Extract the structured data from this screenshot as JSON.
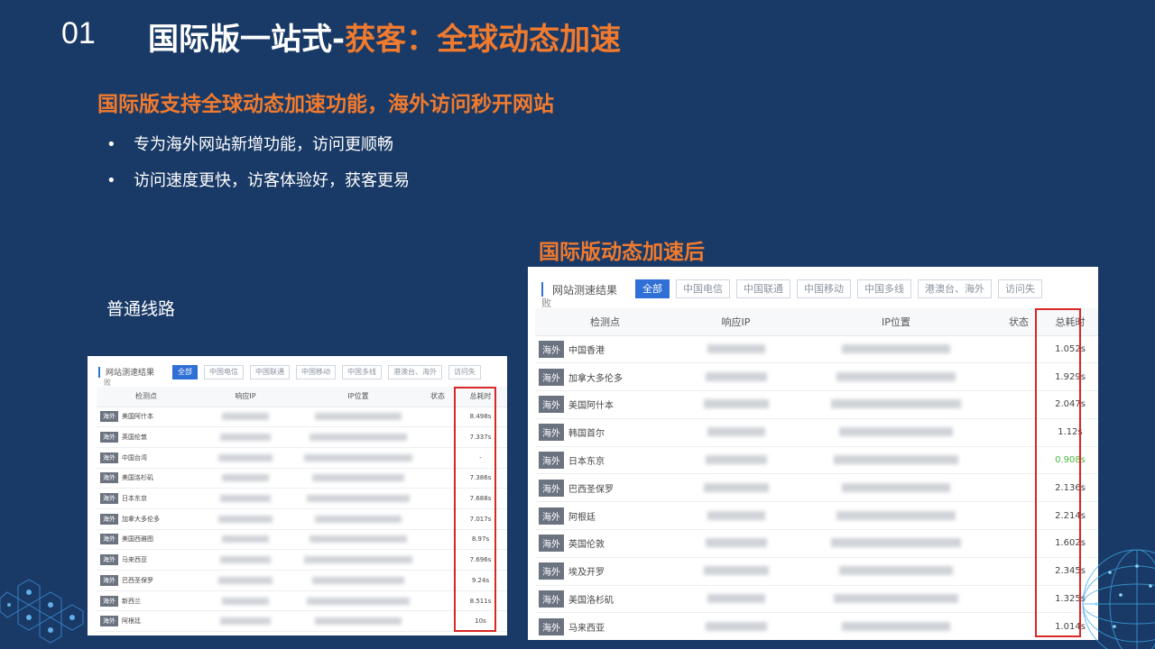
{
  "header": {
    "slide_number": "01",
    "title_main": "国际版一站式-",
    "title_accent": "获客：全球动态加速"
  },
  "subtitle": "国际版支持全球动态加速功能，海外访问秒开网站",
  "bullets": [
    "专为海外网站新增功能，访问更顺畅",
    "访问速度更快，访客体验好，获客更易"
  ],
  "labels": {
    "normal": "普通线路",
    "after": "国际版动态加速后"
  },
  "panel": {
    "title": "网站测速结果",
    "tabs": [
      "全部",
      "中国电信",
      "中国联通",
      "中国移动",
      "中国多线",
      "港澳台、海外",
      "访问失"
    ],
    "tabs_wrap": "败",
    "columns": [
      "检测点",
      "响应IP",
      "IP位置",
      "状态",
      "总耗时"
    ],
    "region_tag": "海外"
  },
  "normal_rows": [
    {
      "location": "美国阿什本",
      "total": "8.498s"
    },
    {
      "location": "英国伦敦",
      "total": "7.337s"
    },
    {
      "location": "中国台湾",
      "total": "-"
    },
    {
      "location": "美国洛杉矶",
      "total": "7.386s"
    },
    {
      "location": "日本东京",
      "total": "7.688s"
    },
    {
      "location": "加拿大多伦多",
      "total": "7.017s"
    },
    {
      "location": "美国西雅图",
      "total": "8.97s"
    },
    {
      "location": "马来西亚",
      "total": "7.696s"
    },
    {
      "location": "巴西圣保罗",
      "total": "9.24s"
    },
    {
      "location": "新西兰",
      "total": "8.511s"
    },
    {
      "location": "阿根廷",
      "total": "10s"
    }
  ],
  "accel_rows": [
    {
      "location": "中国香港",
      "total": "1.052s"
    },
    {
      "location": "加拿大多伦多",
      "total": "1.929s"
    },
    {
      "location": "美国阿什本",
      "total": "2.047s"
    },
    {
      "location": "韩国首尔",
      "total": "1.12s"
    },
    {
      "location": "日本东京",
      "total": "0.908s"
    },
    {
      "location": "巴西圣保罗",
      "total": "2.136s"
    },
    {
      "location": "阿根廷",
      "total": "2.214s"
    },
    {
      "location": "英国伦敦",
      "total": "1.602s"
    },
    {
      "location": "埃及开罗",
      "total": "2.345s"
    },
    {
      "location": "美国洛杉矶",
      "total": "1.325s"
    },
    {
      "location": "马来西亚",
      "total": "1.014s"
    }
  ],
  "colors": {
    "background": "#193a66",
    "accent": "#f07a2e",
    "tab_active": "#2f6fd6",
    "highlight_box": "#d92626",
    "fast_time": "#48b83a"
  }
}
